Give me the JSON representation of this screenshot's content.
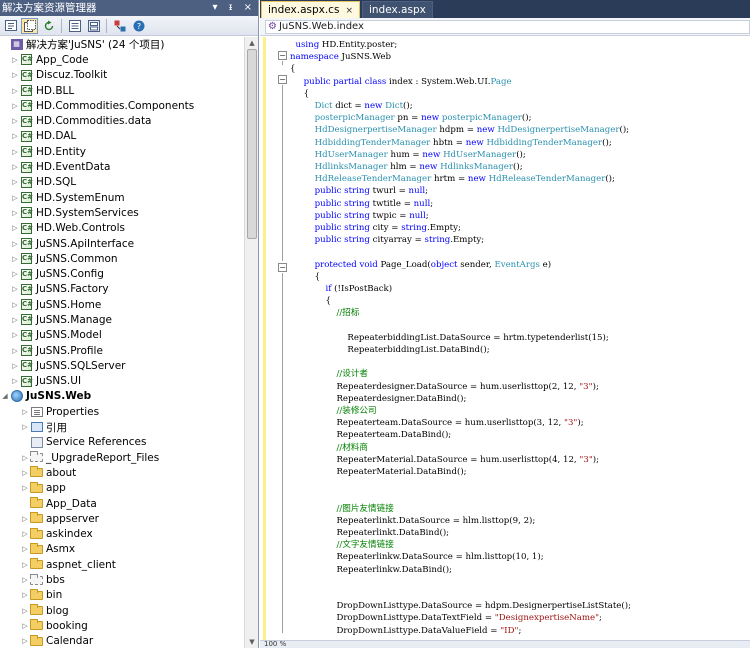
{
  "solution_explorer": {
    "title": "解决方案资源管理器",
    "title_controls": [
      "▾",
      "ᵻ",
      "×"
    ],
    "solution_label": "解决方案'JuSNS' (24 个项目)",
    "items": [
      {
        "label": "App_Code",
        "icon": "project-icon",
        "expand": "▷"
      },
      {
        "label": "Discuz.Toolkit",
        "icon": "project-icon",
        "expand": "▷"
      },
      {
        "label": "HD.BLL",
        "icon": "project-icon",
        "expand": "▷"
      },
      {
        "label": "HD.Commodities.Components",
        "icon": "project-icon",
        "expand": "▷"
      },
      {
        "label": "HD.Commodities.data",
        "icon": "project-icon",
        "expand": "▷"
      },
      {
        "label": "HD.DAL",
        "icon": "project-icon",
        "expand": "▷"
      },
      {
        "label": "HD.Entity",
        "icon": "project-icon",
        "expand": "▷"
      },
      {
        "label": "HD.EventData",
        "icon": "project-icon",
        "expand": "▷"
      },
      {
        "label": "HD.SQL",
        "icon": "project-icon",
        "expand": "▷"
      },
      {
        "label": "HD.SystemEnum",
        "icon": "project-icon",
        "expand": "▷"
      },
      {
        "label": "HD.SystemServices",
        "icon": "project-icon",
        "expand": "▷"
      },
      {
        "label": "HD.Web.Controls",
        "icon": "project-icon",
        "expand": "▷"
      },
      {
        "label": "JuSNS.ApiInterface",
        "icon": "project-icon",
        "expand": "▷"
      },
      {
        "label": "JuSNS.Common",
        "icon": "project-icon",
        "expand": "▷"
      },
      {
        "label": "JuSNS.Config",
        "icon": "project-icon",
        "expand": "▷"
      },
      {
        "label": "JuSNS.Factory",
        "icon": "project-icon",
        "expand": "▷"
      },
      {
        "label": "JuSNS.Home",
        "icon": "project-icon",
        "expand": "▷"
      },
      {
        "label": "JuSNS.Manage",
        "icon": "project-icon",
        "expand": "▷"
      },
      {
        "label": "JuSNS.Model",
        "icon": "project-icon",
        "expand": "▷"
      },
      {
        "label": "JuSNS.Profile",
        "icon": "project-icon",
        "expand": "▷"
      },
      {
        "label": "JuSNS.SQLServer",
        "icon": "project-icon",
        "expand": "▷"
      },
      {
        "label": "JuSNS.UI",
        "icon": "project-icon",
        "expand": "▷"
      }
    ],
    "web_project": {
      "label": "JuSNS.Web",
      "expand": "◢"
    },
    "web_children": [
      {
        "label": "Properties",
        "icon": "properties-icon",
        "expand": "▷"
      },
      {
        "label": "引用",
        "icon": "references-icon",
        "expand": "▷"
      },
      {
        "label": "Service References",
        "icon": "service-references-icon",
        "expand": ""
      },
      {
        "label": "_UpgradeReport_Files",
        "icon": "folder-gray-icon",
        "expand": "▷"
      },
      {
        "label": "about",
        "icon": "folder-icon",
        "expand": "▷"
      },
      {
        "label": "app",
        "icon": "folder-icon",
        "expand": "▷"
      },
      {
        "label": "App_Data",
        "icon": "folder-icon",
        "expand": ""
      },
      {
        "label": "appserver",
        "icon": "folder-icon",
        "expand": "▷"
      },
      {
        "label": "askindex",
        "icon": "folder-icon",
        "expand": "▷"
      },
      {
        "label": "Asmx",
        "icon": "folder-icon",
        "expand": "▷"
      },
      {
        "label": "aspnet_client",
        "icon": "folder-icon",
        "expand": "▷"
      },
      {
        "label": "bbs",
        "icon": "folder-gray-icon",
        "expand": "▷"
      },
      {
        "label": "bin",
        "icon": "folder-icon",
        "expand": "▷"
      },
      {
        "label": "blog",
        "icon": "folder-icon",
        "expand": "▷"
      },
      {
        "label": "booking",
        "icon": "folder-icon",
        "expand": "▷"
      },
      {
        "label": "Calendar",
        "icon": "folder-icon",
        "expand": "▷"
      }
    ]
  },
  "editor": {
    "tabs": [
      {
        "label": "index.aspx.cs",
        "close": "×",
        "active": true
      },
      {
        "label": "index.aspx",
        "close": "",
        "active": false
      }
    ],
    "nav_combo": "JuSNS.Web.index",
    "status_zoom": "100 %",
    "code_lines": [
      [
        [
          "",
          "  "
        ],
        [
          "kw",
          "using"
        ],
        [
          "",
          " HD.Entity.poster;"
        ]
      ],
      [
        [
          "kw",
          "namespace"
        ],
        [
          "",
          " JuSNS.Web"
        ]
      ],
      [
        [
          "",
          "{"
        ]
      ],
      [
        [
          "",
          "     "
        ],
        [
          "kw",
          "public partial class"
        ],
        [
          "",
          " index : System.Web.UI."
        ],
        [
          "ty",
          "Page"
        ]
      ],
      [
        [
          "",
          "     {"
        ]
      ],
      [
        [
          "",
          "         "
        ],
        [
          "ty",
          "Dict"
        ],
        [
          "",
          " dict = "
        ],
        [
          "kw",
          "new"
        ],
        [
          "",
          " "
        ],
        [
          "ty",
          "Dict"
        ],
        [
          "",
          "();"
        ]
      ],
      [
        [
          "",
          "         "
        ],
        [
          "ty",
          "posterpicManager"
        ],
        [
          "",
          " pn = "
        ],
        [
          "kw",
          "new"
        ],
        [
          "",
          " "
        ],
        [
          "ty",
          "posterpicManager"
        ],
        [
          "",
          "();"
        ]
      ],
      [
        [
          "",
          "         "
        ],
        [
          "ty",
          "HdDesignerpertiseManager"
        ],
        [
          "",
          " hdpm = "
        ],
        [
          "kw",
          "new"
        ],
        [
          "",
          " "
        ],
        [
          "ty",
          "HdDesignerpertiseManager"
        ],
        [
          "",
          "();"
        ]
      ],
      [
        [
          "",
          "         "
        ],
        [
          "ty",
          "HdbiddingTenderManager"
        ],
        [
          "",
          " hbtn = "
        ],
        [
          "kw",
          "new"
        ],
        [
          "",
          " "
        ],
        [
          "ty",
          "HdbiddingTenderManager"
        ],
        [
          "",
          "();"
        ]
      ],
      [
        [
          "",
          "         "
        ],
        [
          "ty",
          "HdUserManager"
        ],
        [
          "",
          " hum = "
        ],
        [
          "kw",
          "new"
        ],
        [
          "",
          " "
        ],
        [
          "ty",
          "HdUserManager"
        ],
        [
          "",
          "();"
        ]
      ],
      [
        [
          "",
          "         "
        ],
        [
          "ty",
          "HdlinksManager"
        ],
        [
          "",
          " hlm = "
        ],
        [
          "kw",
          "new"
        ],
        [
          "",
          " "
        ],
        [
          "ty",
          "HdlinksManager"
        ],
        [
          "",
          "();"
        ]
      ],
      [
        [
          "",
          "         "
        ],
        [
          "ty",
          "HdReleaseTenderManager"
        ],
        [
          "",
          " hrtm = "
        ],
        [
          "kw",
          "new"
        ],
        [
          "",
          " "
        ],
        [
          "ty",
          "HdReleaseTenderManager"
        ],
        [
          "",
          "();"
        ]
      ],
      [
        [
          "",
          "         "
        ],
        [
          "kw",
          "public string"
        ],
        [
          "",
          " twurl = "
        ],
        [
          "kw",
          "null"
        ],
        [
          "",
          ";"
        ]
      ],
      [
        [
          "",
          "         "
        ],
        [
          "kw",
          "public string"
        ],
        [
          "",
          " twtitle = "
        ],
        [
          "kw",
          "null"
        ],
        [
          "",
          ";"
        ]
      ],
      [
        [
          "",
          "         "
        ],
        [
          "kw",
          "public string"
        ],
        [
          "",
          " twpic = "
        ],
        [
          "kw",
          "null"
        ],
        [
          "",
          ";"
        ]
      ],
      [
        [
          "",
          "         "
        ],
        [
          "kw",
          "public string"
        ],
        [
          "",
          " city = "
        ],
        [
          "kw",
          "string"
        ],
        [
          "",
          ".Empty;"
        ]
      ],
      [
        [
          "",
          "         "
        ],
        [
          "kw",
          "public string"
        ],
        [
          "",
          " cityarray = "
        ],
        [
          "kw",
          "string"
        ],
        [
          "",
          ".Empty;"
        ]
      ],
      [],
      [
        [
          "",
          "         "
        ],
        [
          "kw",
          "protected void"
        ],
        [
          "",
          " Page_Load("
        ],
        [
          "kw",
          "object"
        ],
        [
          "",
          " sender, "
        ],
        [
          "ty",
          "EventArgs"
        ],
        [
          "",
          " e)"
        ]
      ],
      [
        [
          "",
          "         {"
        ]
      ],
      [
        [
          "",
          "             "
        ],
        [
          "kw",
          "if"
        ],
        [
          "",
          " (!IsPostBack)"
        ]
      ],
      [
        [
          "",
          "             {"
        ]
      ],
      [
        [
          "",
          "                 "
        ],
        [
          "cm",
          "//招标"
        ]
      ],
      [],
      [
        [
          "",
          "                     RepeaterbiddingList.DataSource = hrtm.typetenderlist(15);"
        ]
      ],
      [
        [
          "",
          "                     RepeaterbiddingList.DataBind();"
        ]
      ],
      [],
      [
        [
          "",
          "                 "
        ],
        [
          "cm",
          "//设计者"
        ]
      ],
      [
        [
          "",
          "                 Repeaterdesigner.DataSource = hum.userlisttop(2, 12, "
        ],
        [
          "st",
          "\"3\""
        ],
        [
          "",
          ");"
        ]
      ],
      [
        [
          "",
          "                 Repeaterdesigner.DataBind();"
        ]
      ],
      [
        [
          "",
          "                 "
        ],
        [
          "cm",
          "//装修公司"
        ]
      ],
      [
        [
          "",
          "                 Repeaterteam.DataSource = hum.userlisttop(3, 12, "
        ],
        [
          "st",
          "\"3\""
        ],
        [
          "",
          ");"
        ]
      ],
      [
        [
          "",
          "                 Repeaterteam.DataBind();"
        ]
      ],
      [
        [
          "",
          "                 "
        ],
        [
          "cm",
          "//材料商"
        ]
      ],
      [
        [
          "",
          "                 RepeaterMaterial.DataSource = hum.userlisttop(4, 12, "
        ],
        [
          "st",
          "\"3\""
        ],
        [
          "",
          ");"
        ]
      ],
      [
        [
          "",
          "                 RepeaterMaterial.DataBind();"
        ]
      ],
      [],
      [],
      [
        [
          "",
          "                 "
        ],
        [
          "cm",
          "//图片友情链接"
        ]
      ],
      [
        [
          "",
          "                 Repeaterlinkt.DataSource = hlm.listtop(9, 2);"
        ]
      ],
      [
        [
          "",
          "                 Repeaterlinkt.DataBind();"
        ]
      ],
      [
        [
          "",
          "                 "
        ],
        [
          "cm",
          "//文字友情链接"
        ]
      ],
      [
        [
          "",
          "                 Repeaterlinkw.DataSource = hlm.listtop(10, 1);"
        ]
      ],
      [
        [
          "",
          "                 Repeaterlinkw.DataBind();"
        ]
      ],
      [],
      [],
      [
        [
          "",
          "                 DropDownListtype.DataSource = hdpm.DesignerpertiseListState();"
        ]
      ],
      [
        [
          "",
          "                 DropDownListtype.DataTextField = "
        ],
        [
          "st",
          "\"DesignexpertiseName\""
        ],
        [
          "",
          ";"
        ]
      ],
      [
        [
          "",
          "                 DropDownListtype.DataValueField = "
        ],
        [
          "st",
          "\"ID\""
        ],
        [
          "",
          ";"
        ]
      ]
    ]
  }
}
